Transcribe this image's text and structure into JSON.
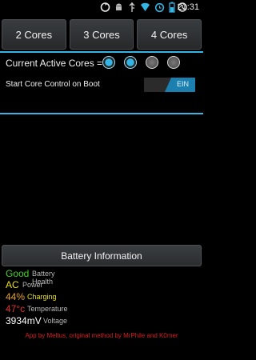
{
  "status_bar": {
    "time": "21:31",
    "icons": [
      "sync-icon",
      "android-robot-icon",
      "usb-debug-icon",
      "wifi-icon",
      "alarm-icon",
      "battery-icon",
      "signal-icon"
    ]
  },
  "core_buttons": [
    {
      "label": "2 Cores"
    },
    {
      "label": "3 Cores"
    },
    {
      "label": "4 Cores"
    }
  ],
  "active_cores": {
    "label": "Current Active Cores =",
    "states": [
      true,
      true,
      false,
      false
    ]
  },
  "boot": {
    "label": "Start Core Control on Boot",
    "toggle_text": "EIN",
    "enabled": true
  },
  "battery": {
    "button_label": "Battery Information",
    "stats": [
      {
        "value": "Good",
        "label": "Battery Health",
        "color": "#4ccf2a"
      },
      {
        "value": "AC",
        "label": "Power",
        "color": "#e8e020"
      },
      {
        "value": "44%",
        "label": "Charging",
        "color": "#e8a020",
        "label_color": "#e8e020"
      },
      {
        "value": "47°c",
        "label": "Temperature",
        "color": "#e03030"
      },
      {
        "value": "3934mV",
        "label": "Voltage",
        "color": "#ffffff"
      }
    ]
  },
  "footer": {
    "text": "App by Meltus, original method by MrPhile and K0mer"
  },
  "colors": {
    "accent": "#33b5e5",
    "background": "#000000"
  }
}
